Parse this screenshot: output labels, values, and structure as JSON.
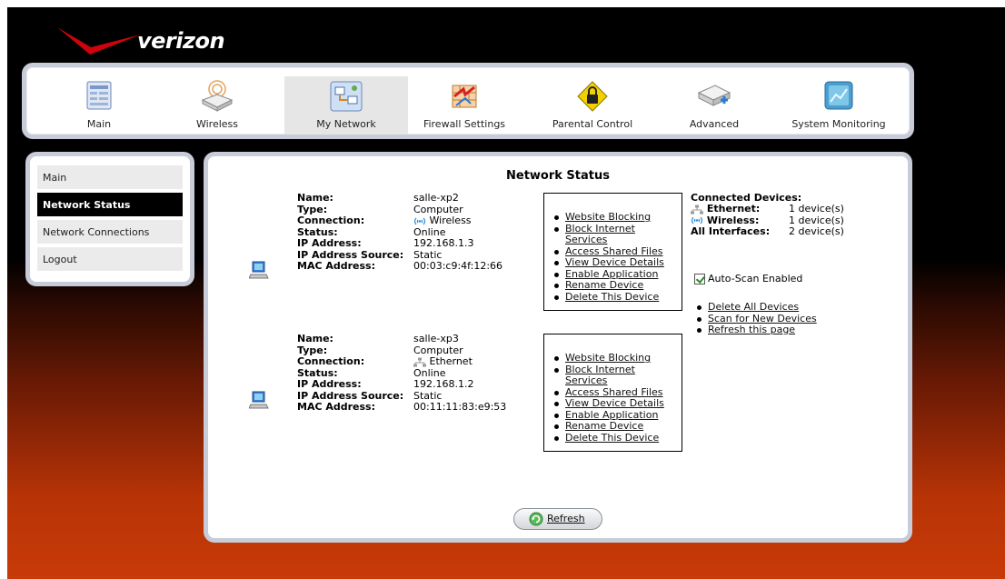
{
  "brand": {
    "logo_text": "verizon",
    "accent": "#cd040b"
  },
  "nav": {
    "items": [
      {
        "label": "Main",
        "icon": "router-panel-icon"
      },
      {
        "label": "Wireless",
        "icon": "wireless-router-icon"
      },
      {
        "label": "My Network",
        "icon": "network-computers-icon"
      },
      {
        "label": "Firewall Settings",
        "icon": "firewall-icon"
      },
      {
        "label": "Parental Control",
        "icon": "padlock-sign-icon"
      },
      {
        "label": "Advanced",
        "icon": "device-plus-icon"
      },
      {
        "label": "System Monitoring",
        "icon": "monitor-icon"
      }
    ],
    "active": "My Network"
  },
  "sidebar": {
    "items": [
      {
        "label": "Main"
      },
      {
        "label": "Network Status"
      },
      {
        "label": "Network Connections"
      },
      {
        "label": "Logout"
      }
    ],
    "active": "Network Status"
  },
  "main": {
    "title": "Network Status",
    "field_labels": {
      "name": "Name:",
      "type": "Type:",
      "connection": "Connection:",
      "status": "Status:",
      "ip": "IP Address:",
      "ip_source": "IP Address Source:",
      "mac": "MAC Address:"
    },
    "devices": [
      {
        "name": "salle-xp2",
        "type": "Computer",
        "connection": "Wireless",
        "connection_icon": "wireless-icon",
        "status": "Online",
        "ip": "192.168.1.3",
        "ip_source": "Static",
        "mac": "00:03:c9:4f:12:66",
        "actions": [
          "Website Blocking",
          "Block Internet",
          "Services",
          "Access Shared Files",
          "View Device Details",
          "Enable Application",
          "Rename Device",
          "Delete This Device"
        ]
      },
      {
        "name": "salle-xp3",
        "type": "Computer",
        "connection": "Ethernet",
        "connection_icon": "ethernet-icon",
        "status": "Online",
        "ip": "192.168.1.2",
        "ip_source": "Static",
        "mac": "00:11:11:83:e9:53",
        "actions": [
          "Website Blocking",
          "Block Internet",
          "Services",
          "Access Shared Files",
          "View Device Details",
          "Enable Application",
          "Rename Device",
          "Delete This Device"
        ]
      }
    ],
    "connected": {
      "header": "Connected Devices:",
      "rows": [
        {
          "label": "Ethernet:",
          "value": "1 device(s)",
          "icon": "ethernet-icon"
        },
        {
          "label": "Wireless:",
          "value": "1 device(s)",
          "icon": "wireless-icon"
        },
        {
          "label": "All Interfaces:",
          "value": "2 device(s)"
        }
      ]
    },
    "auto_scan": {
      "label": "Auto-Scan Enabled",
      "checked": true
    },
    "global_links": [
      "Delete All Devices",
      "Scan for New Devices",
      "Refresh this page"
    ],
    "refresh_label": "Refresh"
  }
}
